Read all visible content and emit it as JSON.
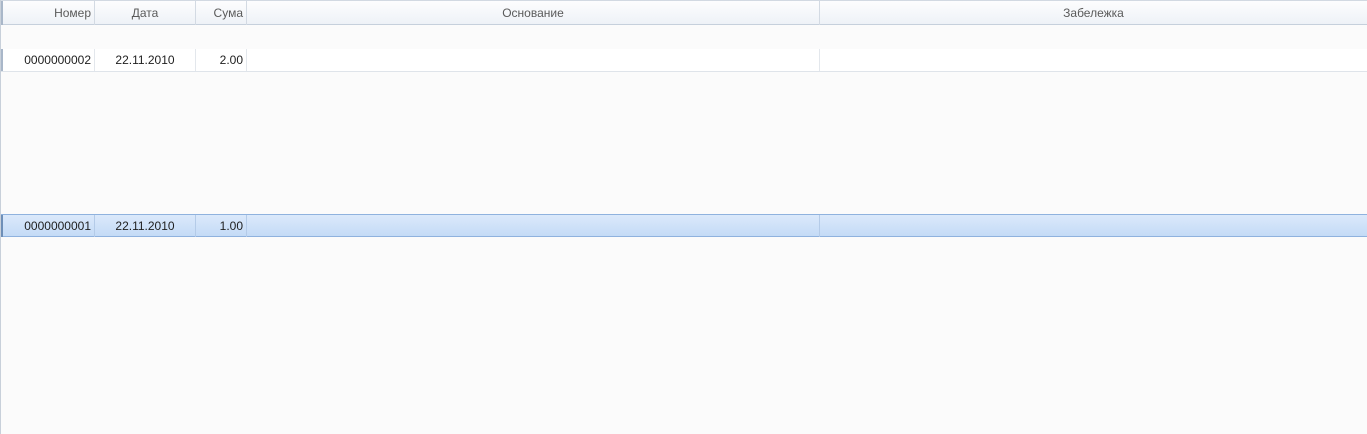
{
  "columns": {
    "number": "Номер",
    "date": "Дата",
    "sum": "Сума",
    "basis": "Основание",
    "note": "Забележка"
  },
  "rows": [
    {
      "number": "0000000002",
      "date": "22.11.2010",
      "sum": "2.00",
      "basis": "",
      "note": "",
      "selected": false
    },
    {
      "number": "0000000001",
      "date": "22.11.2010",
      "sum": "1.00",
      "basis": "",
      "note": "",
      "selected": true
    }
  ],
  "colors": {
    "selection": "#c4dbf6",
    "header": "#eef2f7",
    "background": "#fbfbfb"
  }
}
